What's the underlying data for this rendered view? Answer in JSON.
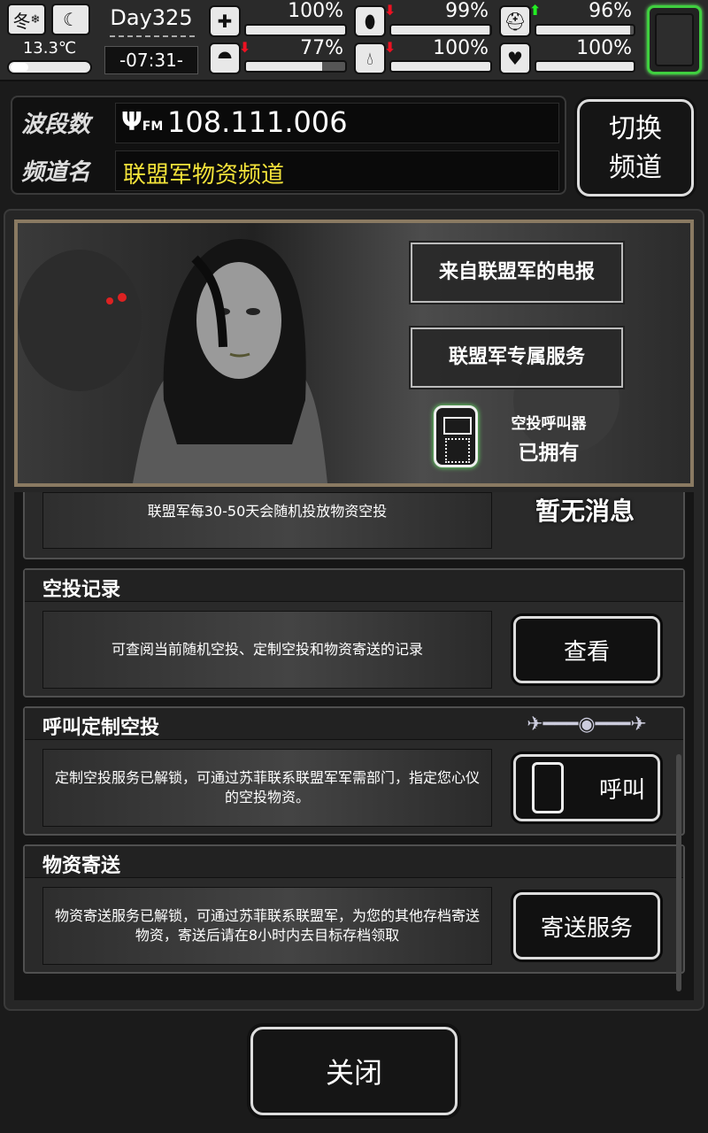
{
  "status": {
    "season": "冬",
    "season_icon": "snowflake-icon",
    "time_of_day_icon": "moon-icon",
    "temperature": "13.3℃",
    "day": "Day325",
    "clock": "-07:31-",
    "stats": [
      {
        "name": "health",
        "icon": "first-aid-kit-icon",
        "value": "100%",
        "level": 1.0,
        "trend": ""
      },
      {
        "name": "hunger",
        "icon": "stomach-icon",
        "value": "99%",
        "level": 0.99,
        "trend": "down"
      },
      {
        "name": "mood",
        "icon": "face-mask-icon",
        "value": "96%",
        "level": 0.96,
        "trend": "up"
      },
      {
        "name": "stamina",
        "icon": "foot-icon",
        "value": "77%",
        "level": 0.77,
        "trend": "down"
      },
      {
        "name": "thirst",
        "icon": "water-drop-icon",
        "value": "100%",
        "level": 1.0,
        "trend": "down"
      },
      {
        "name": "heart",
        "icon": "heart-icon",
        "value": "100%",
        "level": 1.0,
        "trend": ""
      }
    ]
  },
  "radio": {
    "band_label": "波段数",
    "channel_label": "频道名",
    "fm_icon": "antenna-fm-icon",
    "frequency": "108.111.006",
    "channel_name": "联盟军物资频道",
    "switch_button": "切换频道"
  },
  "banner": {
    "telegram_button": "来自联盟军的电报",
    "service_button": "联盟军专属服务",
    "device_name": "空投呼叫器",
    "device_status": "已拥有",
    "device_icon": "walkie-talkie-icon"
  },
  "sections": {
    "random": {
      "body": "联盟军每30-50天会随机投放物资空投",
      "status": "暂无消息"
    },
    "records": {
      "title": "空投记录",
      "body": "可查阅当前随机空投、定制空投和物资寄送的记录",
      "button": "查看"
    },
    "custom": {
      "title": "呼叫定制空投",
      "body": "定制空投服务已解锁，可通过苏菲联系联盟军军需部门，指定您心仪的空投物资。",
      "button": "呼叫",
      "button_icon": "walkie-talkie-icon",
      "deco_icon": "plane-signal-icon"
    },
    "shipping": {
      "title": "物资寄送",
      "body": "物资寄送服务已解锁，可通过苏菲联系联盟军，为您的其他存档寄送物资，寄送后请在8小时内去目标存档领取",
      "button": "寄送服务"
    }
  },
  "close_button": "关闭"
}
